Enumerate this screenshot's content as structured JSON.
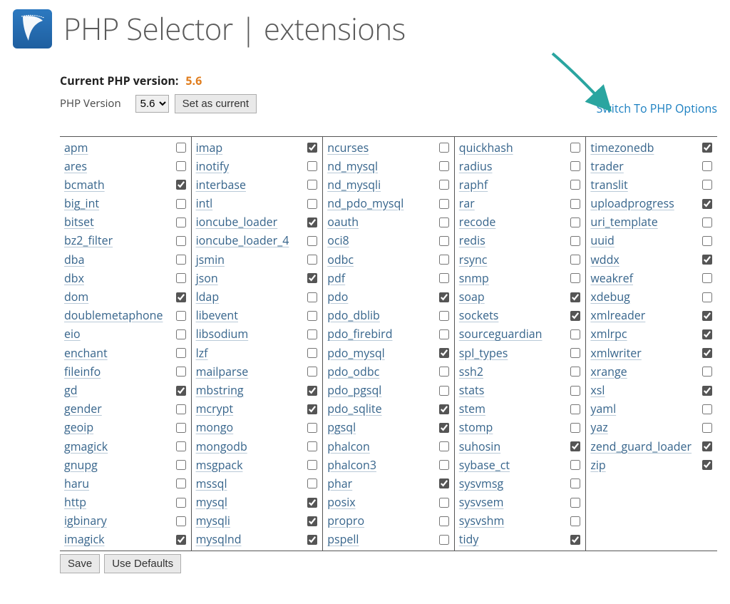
{
  "header": {
    "title": "PHP Selector | extensions"
  },
  "version": {
    "current_label": "Current PHP version:",
    "current_value": "5.6",
    "ctrl_label": "PHP Version",
    "selected": "5.6",
    "options": [
      "5.6"
    ],
    "set_button": "Set as current"
  },
  "switch_link": "Switch To PHP Options",
  "buttons": {
    "save": "Save",
    "use_defaults": "Use Defaults"
  },
  "extensions": {
    "columns": [
      [
        {
          "name": "apm",
          "checked": false
        },
        {
          "name": "ares",
          "checked": false
        },
        {
          "name": "bcmath",
          "checked": true
        },
        {
          "name": "big_int",
          "checked": false
        },
        {
          "name": "bitset",
          "checked": false
        },
        {
          "name": "bz2_filter",
          "checked": false
        },
        {
          "name": "dba",
          "checked": false
        },
        {
          "name": "dbx",
          "checked": false
        },
        {
          "name": "dom",
          "checked": true
        },
        {
          "name": "doublemetaphone",
          "checked": false
        },
        {
          "name": "eio",
          "checked": false
        },
        {
          "name": "enchant",
          "checked": false
        },
        {
          "name": "fileinfo",
          "checked": false
        },
        {
          "name": "gd",
          "checked": true
        },
        {
          "name": "gender",
          "checked": false
        },
        {
          "name": "geoip",
          "checked": false
        },
        {
          "name": "gmagick",
          "checked": false
        },
        {
          "name": "gnupg",
          "checked": false
        },
        {
          "name": "haru",
          "checked": false
        },
        {
          "name": "http",
          "checked": false
        },
        {
          "name": "igbinary",
          "checked": false
        },
        {
          "name": "imagick",
          "checked": true
        }
      ],
      [
        {
          "name": "imap",
          "checked": true
        },
        {
          "name": "inotify",
          "checked": false
        },
        {
          "name": "interbase",
          "checked": false
        },
        {
          "name": "intl",
          "checked": false
        },
        {
          "name": "ioncube_loader",
          "checked": true
        },
        {
          "name": "ioncube_loader_4",
          "checked": false
        },
        {
          "name": "jsmin",
          "checked": false
        },
        {
          "name": "json",
          "checked": true
        },
        {
          "name": "ldap",
          "checked": false
        },
        {
          "name": "libevent",
          "checked": false
        },
        {
          "name": "libsodium",
          "checked": false
        },
        {
          "name": "lzf",
          "checked": false
        },
        {
          "name": "mailparse",
          "checked": false
        },
        {
          "name": "mbstring",
          "checked": true
        },
        {
          "name": "mcrypt",
          "checked": true
        },
        {
          "name": "mongo",
          "checked": false
        },
        {
          "name": "mongodb",
          "checked": false
        },
        {
          "name": "msgpack",
          "checked": false
        },
        {
          "name": "mssql",
          "checked": false
        },
        {
          "name": "mysql",
          "checked": true
        },
        {
          "name": "mysqli",
          "checked": true
        },
        {
          "name": "mysqlnd",
          "checked": true
        }
      ],
      [
        {
          "name": "ncurses",
          "checked": false
        },
        {
          "name": "nd_mysql",
          "checked": false
        },
        {
          "name": "nd_mysqli",
          "checked": false
        },
        {
          "name": "nd_pdo_mysql",
          "checked": false
        },
        {
          "name": "oauth",
          "checked": false
        },
        {
          "name": "oci8",
          "checked": false
        },
        {
          "name": "odbc",
          "checked": false
        },
        {
          "name": "pdf",
          "checked": false
        },
        {
          "name": "pdo",
          "checked": true
        },
        {
          "name": "pdo_dblib",
          "checked": false
        },
        {
          "name": "pdo_firebird",
          "checked": false
        },
        {
          "name": "pdo_mysql",
          "checked": true
        },
        {
          "name": "pdo_odbc",
          "checked": false
        },
        {
          "name": "pdo_pgsql",
          "checked": false
        },
        {
          "name": "pdo_sqlite",
          "checked": true
        },
        {
          "name": "pgsql",
          "checked": true
        },
        {
          "name": "phalcon",
          "checked": false
        },
        {
          "name": "phalcon3",
          "checked": false
        },
        {
          "name": "phar",
          "checked": true
        },
        {
          "name": "posix",
          "checked": false
        },
        {
          "name": "propro",
          "checked": false
        },
        {
          "name": "pspell",
          "checked": false
        }
      ],
      [
        {
          "name": "quickhash",
          "checked": false
        },
        {
          "name": "radius",
          "checked": false
        },
        {
          "name": "raphf",
          "checked": false
        },
        {
          "name": "rar",
          "checked": false
        },
        {
          "name": "recode",
          "checked": false
        },
        {
          "name": "redis",
          "checked": false
        },
        {
          "name": "rsync",
          "checked": false
        },
        {
          "name": "snmp",
          "checked": false
        },
        {
          "name": "soap",
          "checked": true
        },
        {
          "name": "sockets",
          "checked": true
        },
        {
          "name": "sourceguardian",
          "checked": false
        },
        {
          "name": "spl_types",
          "checked": false
        },
        {
          "name": "ssh2",
          "checked": false
        },
        {
          "name": "stats",
          "checked": false
        },
        {
          "name": "stem",
          "checked": false
        },
        {
          "name": "stomp",
          "checked": false
        },
        {
          "name": "suhosin",
          "checked": true
        },
        {
          "name": "sybase_ct",
          "checked": false
        },
        {
          "name": "sysvmsg",
          "checked": false
        },
        {
          "name": "sysvsem",
          "checked": false
        },
        {
          "name": "sysvshm",
          "checked": false
        },
        {
          "name": "tidy",
          "checked": true
        }
      ],
      [
        {
          "name": "timezonedb",
          "checked": true
        },
        {
          "name": "trader",
          "checked": false
        },
        {
          "name": "translit",
          "checked": false
        },
        {
          "name": "uploadprogress",
          "checked": true
        },
        {
          "name": "uri_template",
          "checked": false
        },
        {
          "name": "uuid",
          "checked": false
        },
        {
          "name": "wddx",
          "checked": true
        },
        {
          "name": "weakref",
          "checked": false
        },
        {
          "name": "xdebug",
          "checked": false
        },
        {
          "name": "xmlreader",
          "checked": true
        },
        {
          "name": "xmlrpc",
          "checked": true
        },
        {
          "name": "xmlwriter",
          "checked": true
        },
        {
          "name": "xrange",
          "checked": false
        },
        {
          "name": "xsl",
          "checked": true
        },
        {
          "name": "yaml",
          "checked": false
        },
        {
          "name": "yaz",
          "checked": false
        },
        {
          "name": "zend_guard_loader",
          "checked": true
        },
        {
          "name": "zip",
          "checked": true
        }
      ]
    ]
  }
}
